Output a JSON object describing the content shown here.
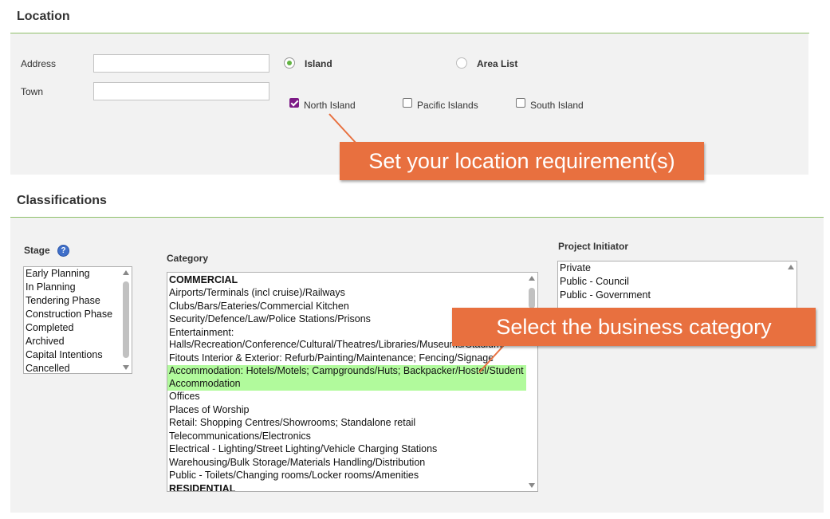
{
  "location": {
    "title": "Location",
    "address_label": "Address",
    "address_value": "",
    "town_label": "Town",
    "town_value": "",
    "radio_island": "Island",
    "radio_area_list": "Area List",
    "selected_radio": "Island",
    "checkboxes": [
      {
        "label": "North Island",
        "checked": true
      },
      {
        "label": "Pacific Islands",
        "checked": false
      },
      {
        "label": "South Island",
        "checked": false
      }
    ],
    "callout": "Set your location requirement(s)"
  },
  "classifications": {
    "title": "Classifications",
    "stage": {
      "label": "Stage",
      "help_icon": "question-icon",
      "options": [
        "Early Planning",
        "In Planning",
        "Tendering Phase",
        "Construction Phase",
        "Completed",
        "Archived",
        "Capital Intentions",
        "Cancelled"
      ]
    },
    "category": {
      "label": "Category",
      "options": [
        {
          "text": "COMMERCIAL",
          "group": true
        },
        {
          "text": "Airports/Terminals (incl cruise)/Railways"
        },
        {
          "text": "Clubs/Bars/Eateries/Commercial Kitchen"
        },
        {
          "text": "Security/Defence/Law/Police Stations/Prisons"
        },
        {
          "text": "Entertainment: Halls/Recreation/Conference/Cultural/Theatres/Libraries/Museums/Stadium"
        },
        {
          "text": "Fitouts Interior & Exterior: Refurb/Painting/Maintenance; Fencing/Signage"
        },
        {
          "text": "Accommodation: Hotels/Motels; Campgrounds/Huts; Backpacker/Hostel/Student Accommodation",
          "selected": true
        },
        {
          "text": "Offices"
        },
        {
          "text": "Places of Worship"
        },
        {
          "text": "Retail: Shopping Centres/Showrooms; Standalone retail"
        },
        {
          "text": "Telecommunications/Electronics"
        },
        {
          "text": "Electrical - Lighting/Street Lighting/Vehicle Charging Stations"
        },
        {
          "text": "Warehousing/Bulk Storage/Materials Handling/Distribution"
        },
        {
          "text": "Public - Toilets/Changing rooms/Locker rooms/Amenities"
        },
        {
          "text": "RESIDENTIAL",
          "group": true
        }
      ],
      "callout": "Select the business category"
    },
    "project_initiator": {
      "label": "Project Initiator",
      "options": [
        "Private",
        "Public - Council",
        "Public - Government"
      ]
    }
  },
  "colors": {
    "accent_green": "#62b342",
    "selected_row": "#b1fa9c",
    "callout": "#e8703f",
    "checkbox_checked": "#7d1a86"
  }
}
